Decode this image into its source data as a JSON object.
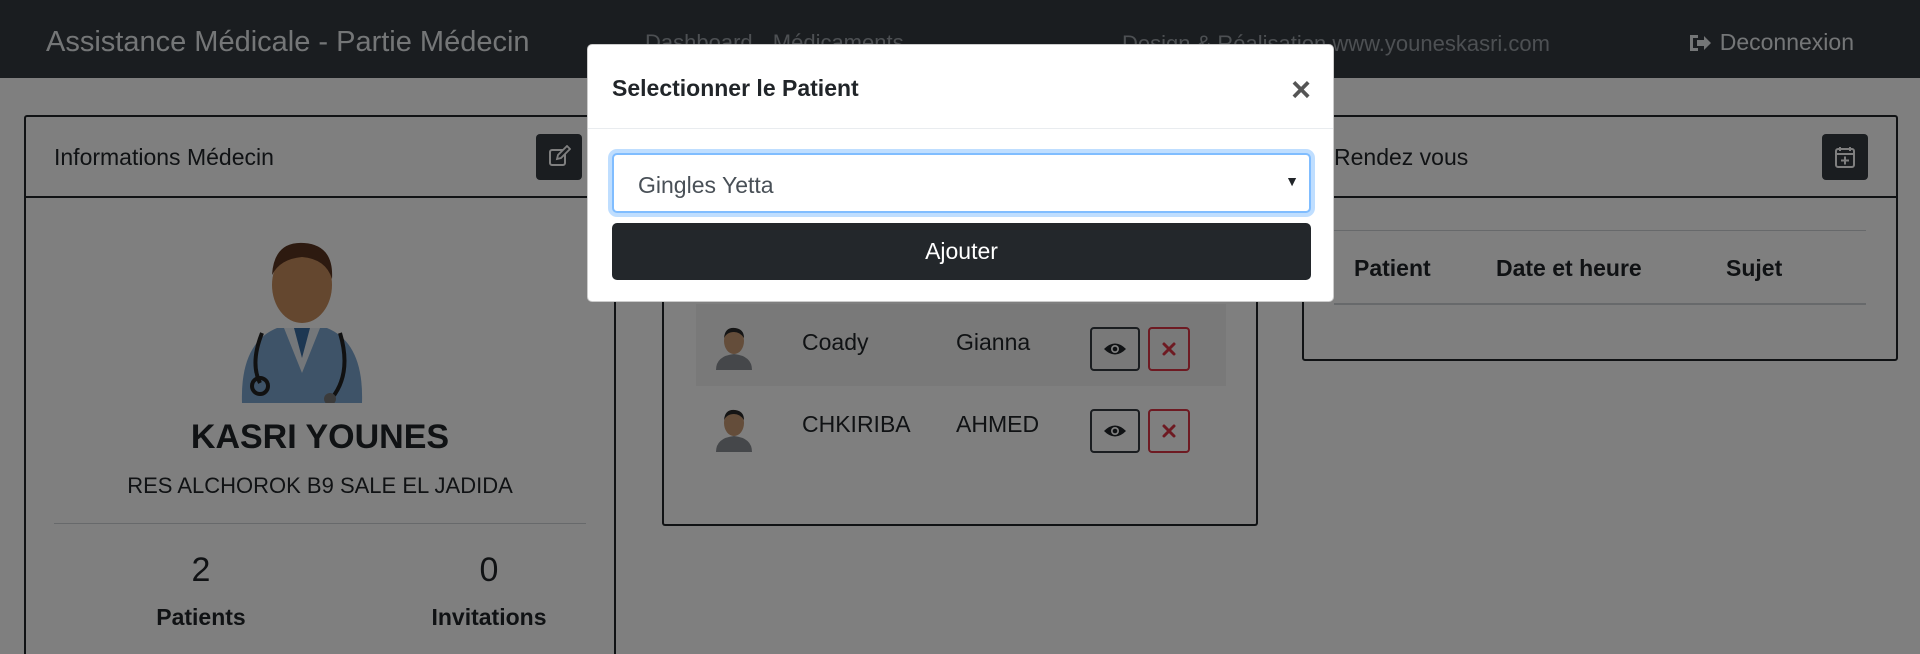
{
  "navbar": {
    "brand": "Assistance Médicale - Partie Médecin",
    "links": [
      "Dashboard",
      "Médicaments"
    ],
    "credit": "Design & Réalisation www.youneskasri.com",
    "logout_label": "Deconnexion",
    "logout_icon": "sign-out-icon"
  },
  "doctor": {
    "card_title": "Informations Médecin",
    "edit_icon": "edit-icon",
    "name": "KASRI YOUNES",
    "address": "RES ALCHOROK B9 SALE EL JADIDA",
    "stats": [
      {
        "value": "2",
        "label": "Patients"
      },
      {
        "value": "0",
        "label": "Invitations"
      }
    ]
  },
  "patients": {
    "rows": [
      {
        "last_name": "Coady",
        "first_name": "Gianna"
      },
      {
        "last_name": "CHKIRIBA",
        "first_name": "AHMED"
      }
    ]
  },
  "appointments": {
    "card_title": "Rendez vous",
    "add_icon": "calendar-plus-icon",
    "columns": [
      "Patient",
      "Date et heure",
      "Sujet"
    ]
  },
  "modal": {
    "title": "Selectionner le Patient",
    "close_label": "×",
    "selected_patient": "Gingles Yetta",
    "submit_label": "Ajouter"
  },
  "colors": {
    "navbar": "#343a40",
    "danger": "#dc3545",
    "focus": "#80bdff"
  }
}
